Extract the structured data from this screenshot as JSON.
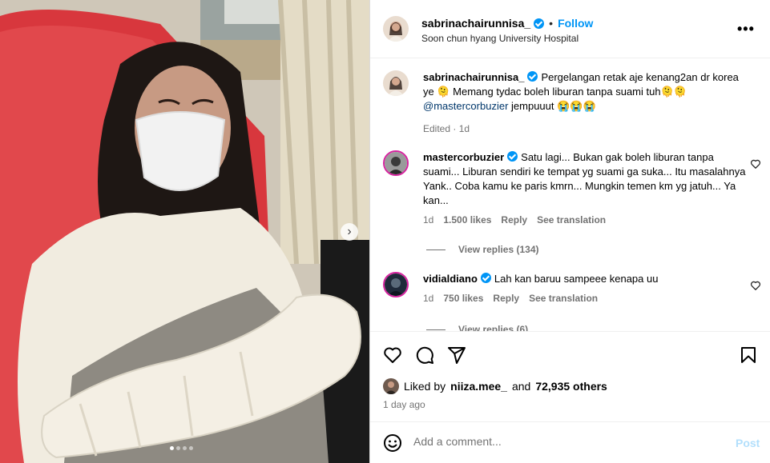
{
  "post": {
    "username": "sabrinachairunnisa_",
    "follow_label": "Follow",
    "location": "Soon chun hyang University Hospital",
    "caption": {
      "username": "sabrinachairunnisa_",
      "text": "Pergelangan retak aje kenang2an dr korea ye 🫠 Memang tydac boleh liburan tanpa suami tuh🫠🫠",
      "mention": "@mastercorbuzier",
      "text_after": " jempuuut 😭😭😭",
      "edited": "Edited · 1d"
    },
    "comments": [
      {
        "username": "mastercorbuzier",
        "text": "Satu lagi... Bukan gak boleh liburan tanpa suami... Liburan sendiri ke tempat yg suami ga suka... Itu masalahnya Yank.. Coba kamu ke paris kmrn... Mungkin temen km yg jatuh... Ya kan...",
        "time": "1d",
        "likes": "1.500 likes",
        "reply": "Reply",
        "translate": "See translation",
        "view_replies": "View replies (134)"
      },
      {
        "username": "vidialdiano",
        "text": "Lah kan baruu sampeee kenapa uu",
        "time": "1d",
        "likes": "750 likes",
        "reply": "Reply",
        "translate": "See translation",
        "view_replies": "View replies (6)"
      }
    ],
    "likes": {
      "prefix": "Liked by",
      "user": "niiza.mee_",
      "conj": "and",
      "others": "72,935 others"
    },
    "time_ago": "1 day ago",
    "add_comment": {
      "placeholder": "Add a comment...",
      "post_label": "Post"
    },
    "carousel": {
      "count": 4,
      "active": 1
    }
  },
  "colors": {
    "accent": "#0095f6",
    "secondary_text": "#737373",
    "post_disabled": "#b2dffc",
    "mention": "#00376b"
  },
  "icons": [
    "verified-badge-icon",
    "more-options-icon",
    "heart-icon",
    "comment-icon",
    "share-icon",
    "save-bookmark-icon",
    "emoji-icon",
    "chevron-right-icon"
  ]
}
